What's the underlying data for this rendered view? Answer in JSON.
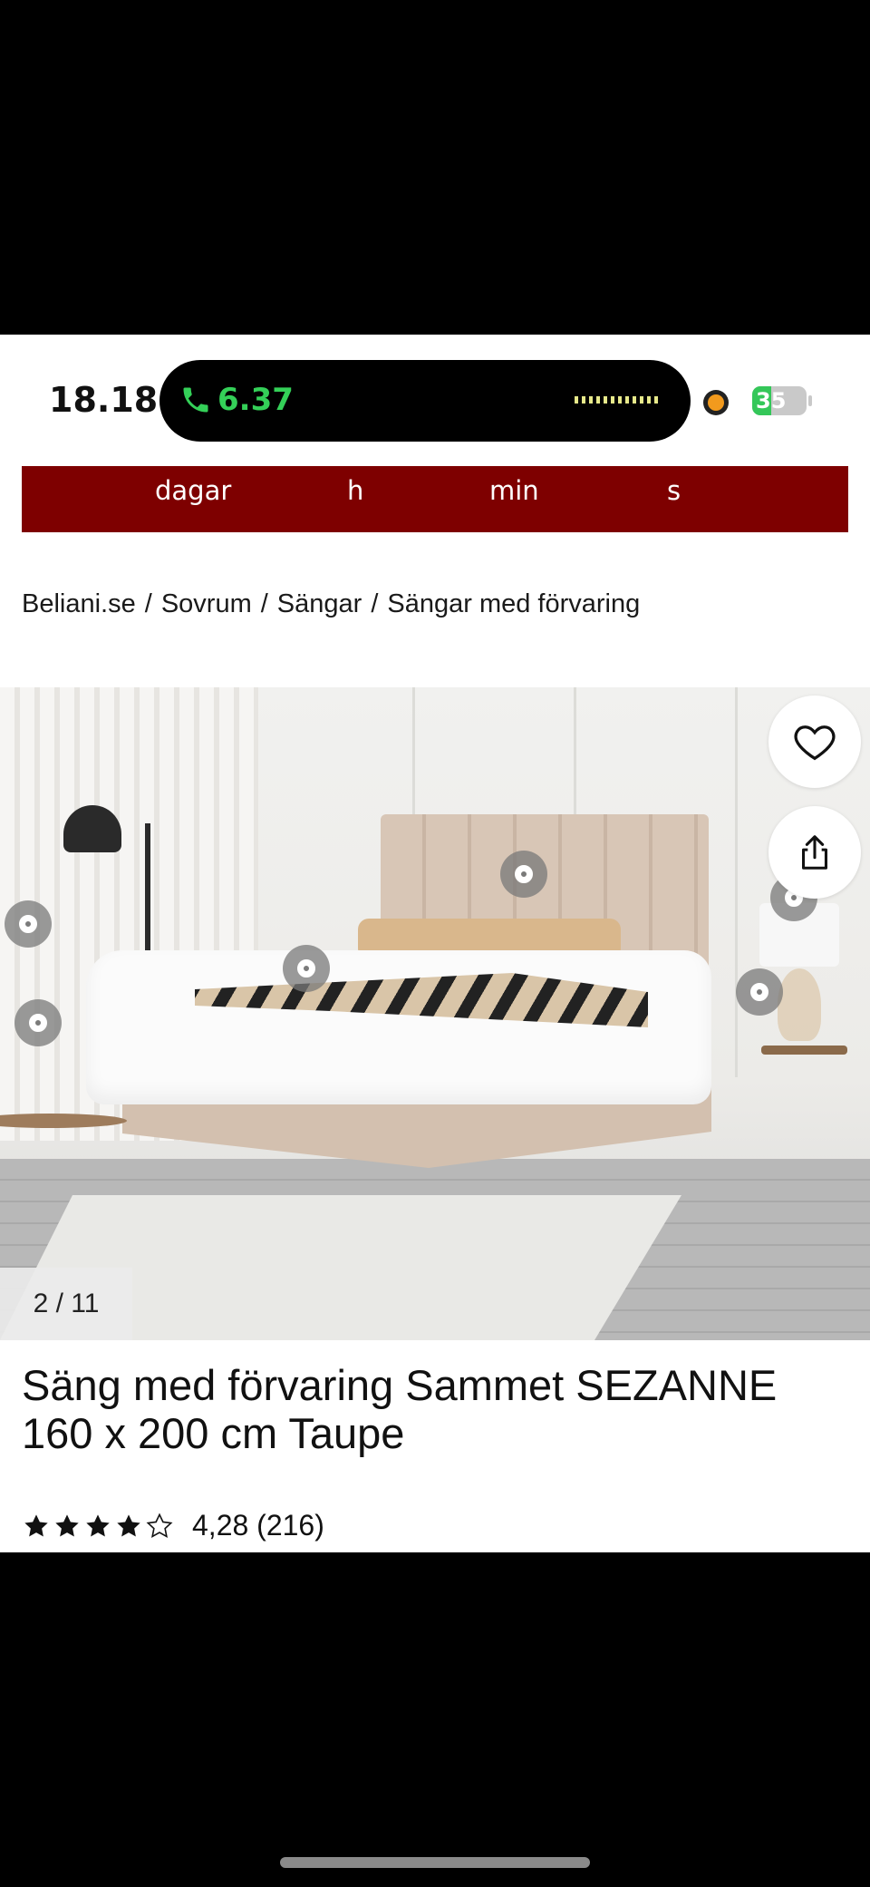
{
  "status_bar": {
    "time": "18.18",
    "call_duration": "6.37",
    "battery_level": "35",
    "icons": [
      "phone-icon",
      "recording-dot-icon",
      "battery-charging-icon"
    ]
  },
  "promo_bar": {
    "units": [
      "dagar",
      "h",
      "min",
      "s"
    ],
    "background_color": "#7e0000"
  },
  "breadcrumb": {
    "items": [
      "Beliani.se",
      "Sovrum",
      "Sängar",
      "Sängar med förvaring"
    ],
    "separator": "/"
  },
  "gallery": {
    "counter": "2 / 11",
    "current_image": 2,
    "total_images": 11,
    "actions": [
      "heart-icon",
      "share-icon"
    ]
  },
  "product": {
    "title": "Säng med förvaring Sammet SEZANNE 160 x 200 cm Taupe",
    "rating_value": 4.28,
    "rating_text": "4,28 (216)",
    "rating_stars_filled": 4,
    "rating_stars_total": 5,
    "review_count": 216
  }
}
